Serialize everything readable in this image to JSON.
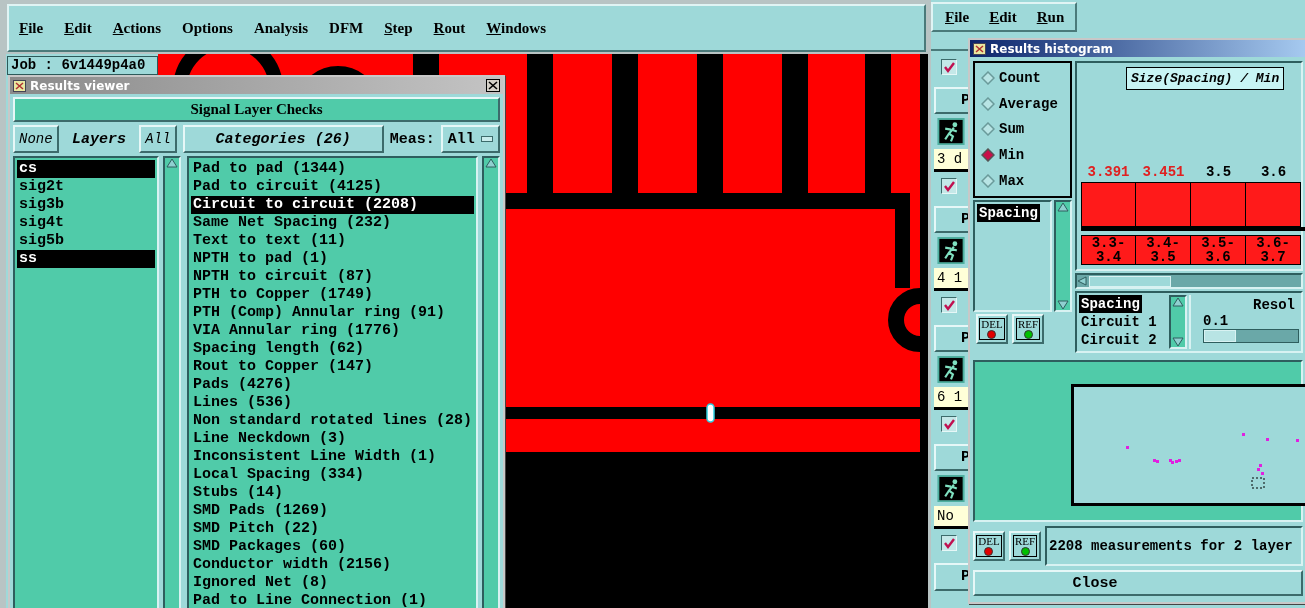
{
  "main_menu": [
    {
      "label": "File",
      "mnemonic": true
    },
    {
      "label": "Edit",
      "mnemonic": true
    },
    {
      "label": "Actions",
      "mnemonic": true
    },
    {
      "label": "Options",
      "mnemonic": false
    },
    {
      "label": "Analysis",
      "mnemonic": false
    },
    {
      "label": "DFM",
      "mnemonic": false
    },
    {
      "label": "Step",
      "mnemonic": true
    },
    {
      "label": "Rout",
      "mnemonic": true
    },
    {
      "label": "Windows",
      "mnemonic": true
    }
  ],
  "job_label": "Job : 6v1449p4a0",
  "results_viewer": {
    "title": "Results viewer",
    "header_button": "Signal Layer Checks",
    "layers_none": "None",
    "layers_title": "Layers",
    "layers_all": "All",
    "categories_button": "Categories (26)",
    "meas_label": "Meas:",
    "meas_value": "All",
    "layers": [
      {
        "name": "cs",
        "selected": true
      },
      {
        "name": "sig2t",
        "selected": false
      },
      {
        "name": "sig3b",
        "selected": false
      },
      {
        "name": "sig4t",
        "selected": false
      },
      {
        "name": "sig5b",
        "selected": false
      },
      {
        "name": "ss",
        "selected": true
      }
    ],
    "categories": [
      {
        "label": "Pad to pad (1344)",
        "selected": false
      },
      {
        "label": "Pad to circuit (4125)",
        "selected": false
      },
      {
        "label": "Circuit to circuit (2208)",
        "selected": true
      },
      {
        "label": "Same Net Spacing (232)",
        "selected": false
      },
      {
        "label": "Text to text (11)",
        "selected": false
      },
      {
        "label": "NPTH to pad (1)",
        "selected": false
      },
      {
        "label": "NPTH to circuit (87)",
        "selected": false
      },
      {
        "label": "PTH to Copper (1749)",
        "selected": false
      },
      {
        "label": "PTH (Comp) Annular ring (91)",
        "selected": false
      },
      {
        "label": "VIA Annular ring (1776)",
        "selected": false
      },
      {
        "label": "Spacing length (62)",
        "selected": false
      },
      {
        "label": "Rout to Copper (147)",
        "selected": false
      },
      {
        "label": "Pads (4276)",
        "selected": false
      },
      {
        "label": "Lines (536)",
        "selected": false
      },
      {
        "label": "Non standard rotated lines (28)",
        "selected": false
      },
      {
        "label": "Line Neckdown (3)",
        "selected": false
      },
      {
        "label": "Inconsistent Line Width (1)",
        "selected": false
      },
      {
        "label": "Local Spacing (334)",
        "selected": false
      },
      {
        "label": "Stubs (14)",
        "selected": false
      },
      {
        "label": "SMD Pads (1269)",
        "selected": false
      },
      {
        "label": "SMD Pitch (22)",
        "selected": false
      },
      {
        "label": "SMD Packages (60)",
        "selected": false
      },
      {
        "label": "Conductor width (2156)",
        "selected": false
      },
      {
        "label": "Ignored Net (8)",
        "selected": false
      },
      {
        "label": "Pad to Line Connection (1)",
        "selected": false
      }
    ]
  },
  "side_menu": [
    {
      "label": "File",
      "mnemonic": true
    },
    {
      "label": "Edit",
      "mnemonic": true
    },
    {
      "label": "Run",
      "mnemonic": true
    }
  ],
  "side_panel": [
    {
      "checked": true,
      "button": "P",
      "label": "3 d"
    },
    {
      "checked": true,
      "button": "P",
      "label": "4 1"
    },
    {
      "checked": true,
      "button": "P",
      "label": "6 1"
    },
    {
      "checked": true,
      "button": "P",
      "label": "No"
    },
    {
      "checked": true,
      "button": "P"
    }
  ],
  "histogram": {
    "title": "Results histogram",
    "modes": [
      {
        "label": "Count",
        "selected": false
      },
      {
        "label": "Average",
        "selected": false
      },
      {
        "label": "Sum",
        "selected": false
      },
      {
        "label": "Min",
        "selected": true
      },
      {
        "label": "Max",
        "selected": false
      }
    ],
    "measures": [
      {
        "label": "Spacing",
        "selected": true
      }
    ],
    "measure_buttons": [
      {
        "label": "DEL",
        "kind": "del"
      },
      {
        "label": "REF",
        "kind": "ref"
      }
    ],
    "chart_title": "Size(Spacing) / Min",
    "bins": [
      {
        "value": "3.391",
        "range": "3.3-3.4",
        "flagged": true
      },
      {
        "value": "3.451",
        "range": "3.4-3.5",
        "flagged": true
      },
      {
        "value": "3.5",
        "range": "3.5-3.6",
        "flagged": false
      },
      {
        "value": "3.6",
        "range": "3.6-3.7",
        "flagged": false
      }
    ],
    "filters": [
      {
        "label": "Spacing",
        "selected": true
      },
      {
        "label": "Circuit 1",
        "selected": false
      },
      {
        "label": "Circuit 2",
        "selected": false
      }
    ],
    "resolution_title": "Resol",
    "resolution_value": "0.1",
    "resolution": {
      "level": 0
    },
    "status_buttons": [
      {
        "label": "DEL",
        "kind": "del"
      },
      {
        "label": "REF",
        "kind": "ref"
      }
    ],
    "status": "2208 measurements for 2 layer",
    "close": "Close"
  }
}
